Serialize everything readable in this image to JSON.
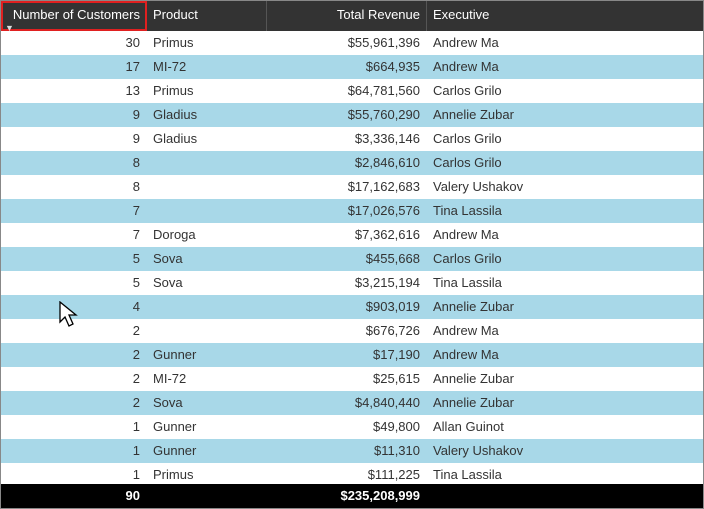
{
  "columns": {
    "customers": "Number of Customers",
    "product": "Product",
    "revenue": "Total Revenue",
    "executive": "Executive"
  },
  "rows": [
    {
      "customers": "30",
      "product": "Primus",
      "revenue": "$55,961,396",
      "executive": "Andrew Ma"
    },
    {
      "customers": "17",
      "product": "MI-72",
      "revenue": "$664,935",
      "executive": "Andrew Ma"
    },
    {
      "customers": "13",
      "product": "Primus",
      "revenue": "$64,781,560",
      "executive": "Carlos Grilo"
    },
    {
      "customers": "9",
      "product": "Gladius",
      "revenue": "$55,760,290",
      "executive": "Annelie Zubar"
    },
    {
      "customers": "9",
      "product": "Gladius",
      "revenue": "$3,336,146",
      "executive": "Carlos Grilo"
    },
    {
      "customers": "8",
      "product": "",
      "revenue": "$2,846,610",
      "executive": "Carlos Grilo"
    },
    {
      "customers": "8",
      "product": "",
      "revenue": "$17,162,683",
      "executive": "Valery Ushakov"
    },
    {
      "customers": "7",
      "product": "",
      "revenue": "$17,026,576",
      "executive": "Tina Lassila"
    },
    {
      "customers": "7",
      "product": "Doroga",
      "revenue": "$7,362,616",
      "executive": "Andrew Ma"
    },
    {
      "customers": "5",
      "product": "Sova",
      "revenue": "$455,668",
      "executive": "Carlos Grilo"
    },
    {
      "customers": "5",
      "product": "Sova",
      "revenue": "$3,215,194",
      "executive": "Tina Lassila"
    },
    {
      "customers": "4",
      "product": "",
      "revenue": "$903,019",
      "executive": "Annelie Zubar"
    },
    {
      "customers": "2",
      "product": "",
      "revenue": "$676,726",
      "executive": "Andrew Ma"
    },
    {
      "customers": "2",
      "product": "Gunner",
      "revenue": "$17,190",
      "executive": "Andrew Ma"
    },
    {
      "customers": "2",
      "product": "MI-72",
      "revenue": "$25,615",
      "executive": "Annelie Zubar"
    },
    {
      "customers": "2",
      "product": "Sova",
      "revenue": "$4,840,440",
      "executive": "Annelie Zubar"
    },
    {
      "customers": "1",
      "product": "Gunner",
      "revenue": "$49,800",
      "executive": "Allan Guinot"
    },
    {
      "customers": "1",
      "product": "Gunner",
      "revenue": "$11,310",
      "executive": "Valery Ushakov"
    },
    {
      "customers": "1",
      "product": "Primus",
      "revenue": "$111,225",
      "executive": "Tina Lassila"
    }
  ],
  "totals": {
    "customers": "90",
    "revenue": "$235,208,999"
  },
  "sort_indicator": "▼"
}
